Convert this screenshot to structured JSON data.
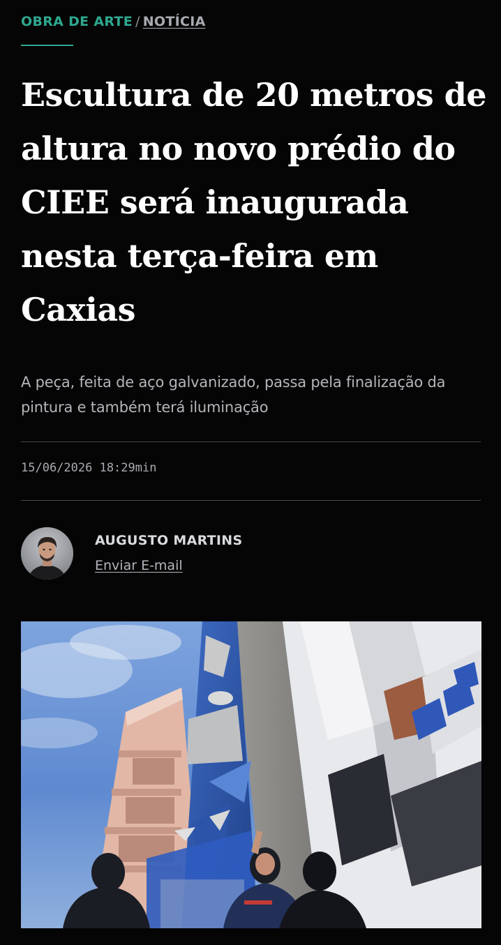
{
  "breadcrumb": {
    "section": "OBRA DE ARTE",
    "separator": "/",
    "current": "NOTÍCIA"
  },
  "article": {
    "headline": "Escultura de 20 metros de altura no novo prédio do CIEE será inaugurada nesta terça-feira em Caxias",
    "subheadline": "A peça, feita de aço galvanizado, passa pela finalização da pintura e também terá iluminação",
    "published": "15/06/2026 18:29min"
  },
  "author": {
    "name": "AUGUSTO MARTINS",
    "email_link": "Enviar E-mail"
  },
  "colors": {
    "accent": "#2fa88f",
    "background": "#050505",
    "headline": "#ffffff",
    "muted_text": "#b4b6bc",
    "divider": "#4a4b52"
  },
  "icons": {
    "avatar": "author-portrait",
    "photo": "sculpture-building-photo"
  }
}
